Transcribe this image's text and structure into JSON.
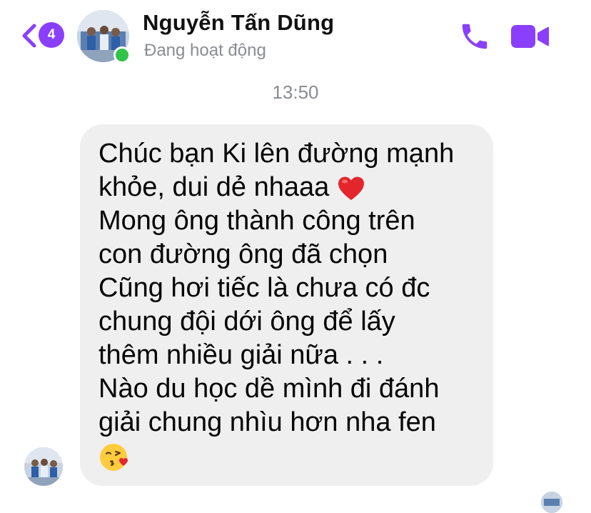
{
  "header": {
    "badge_count": "4",
    "contact_name": "Nguyễn Tấn Dũng",
    "status": "Đang hoạt động",
    "accent_color": "#8a3ffc",
    "online_color": "#31c24a",
    "icons": [
      "chevron-left-icon",
      "phone-icon",
      "video-camera-icon"
    ]
  },
  "conversation": {
    "timestamp": "13:50",
    "message": {
      "lines": [
        "Chúc bạn Ki lên đường mạnh",
        "khỏe, dui dẻ nhaaa",
        "Mong ông thành công trên",
        "con đường ông đã chọn",
        "Cũng hơi tiếc là chưa có đc",
        "chung đội dới ông để lấy",
        "thêm nhiều giải nữa . . .",
        "Nào du học dề mình đi đánh",
        "giải chung nhìu hơn nha fen"
      ],
      "emojis": [
        "red-heart-emoji",
        "face-blowing-kiss-emoji"
      ]
    }
  }
}
